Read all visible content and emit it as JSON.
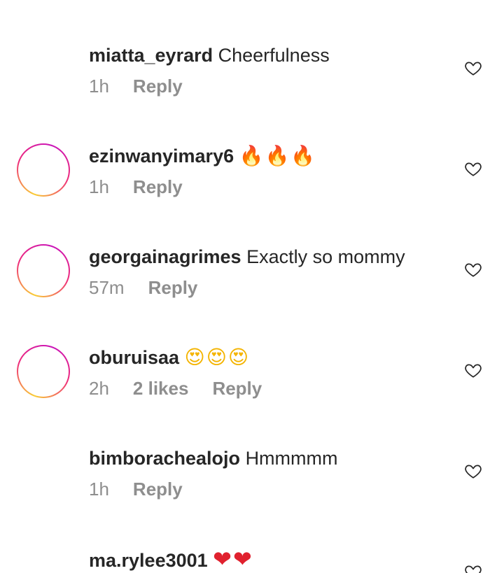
{
  "comments": [
    {
      "username": "miatta_eyrard",
      "text": "Cheerfulness",
      "emoji": "",
      "time": "1h",
      "likes": "",
      "reply_label": "Reply",
      "has_avatar_ring": false
    },
    {
      "username": "ezinwanyimary6",
      "text": "",
      "emoji": "🔥🔥🔥",
      "time": "1h",
      "likes": "",
      "reply_label": "Reply",
      "has_avatar_ring": true
    },
    {
      "username": "georgainagrimes",
      "text": "Exactly so mommy",
      "emoji": "",
      "time": "57m",
      "likes": "",
      "reply_label": "Reply",
      "has_avatar_ring": true
    },
    {
      "username": "oburuisaa",
      "text": "",
      "emoji": "😍😍😍",
      "time": "2h",
      "likes": "2 likes",
      "reply_label": "Reply",
      "has_avatar_ring": true
    },
    {
      "username": "bimborachealojo",
      "text": "Hmmmmm",
      "emoji": "",
      "time": "1h",
      "likes": "",
      "reply_label": "Reply",
      "has_avatar_ring": false
    },
    {
      "username": "ma.rylee3001",
      "text": "",
      "emoji": "❤❤",
      "time": "",
      "likes": "",
      "reply_label": "",
      "has_avatar_ring": false
    }
  ],
  "icons": {
    "like": "heart-outline-icon"
  },
  "colors": {
    "username": "#262626",
    "meta": "#8e8e8e",
    "ring_start": "#f9ce34",
    "ring_mid": "#ee2a7b",
    "ring_end": "#c913b9"
  }
}
